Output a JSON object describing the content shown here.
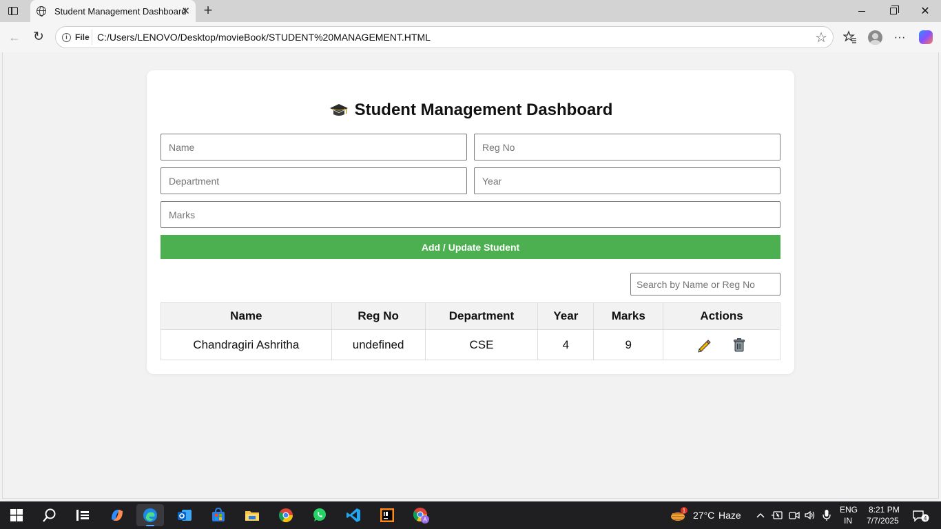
{
  "browser": {
    "tab_title": "Student Management Dashboard",
    "tab_close": "✕",
    "new_tab": "+",
    "address_scheme_label": "File",
    "url": "C:/Users/LENOVO/Desktop/movieBook/STUDENT%20MANAGEMENT.HTML"
  },
  "page": {
    "title": "Student Management Dashboard",
    "form": {
      "name_placeholder": "Name",
      "regno_placeholder": "Reg No",
      "department_placeholder": "Department",
      "year_placeholder": "Year",
      "marks_placeholder": "Marks",
      "submit_label": "Add / Update Student"
    },
    "search_placeholder": "Search by Name or Reg No",
    "table": {
      "headers": [
        "Name",
        "Reg No",
        "Department",
        "Year",
        "Marks",
        "Actions"
      ],
      "rows": [
        {
          "name": "Chandragiri Ashritha",
          "reg_no": "undefined",
          "department": "CSE",
          "year": "4",
          "marks": "9"
        }
      ]
    },
    "colors": {
      "button_green": "#4caf50",
      "header_bg": "#f2f2f2",
      "page_bg": "#f2f2f2"
    }
  },
  "taskbar": {
    "weather_temp": "27°C",
    "weather_desc": "Haze",
    "weather_badge": "1",
    "lang_line1": "ENG",
    "lang_line2": "IN",
    "time": "8:21 PM",
    "date": "7/7/2025",
    "notification_count": "4"
  }
}
